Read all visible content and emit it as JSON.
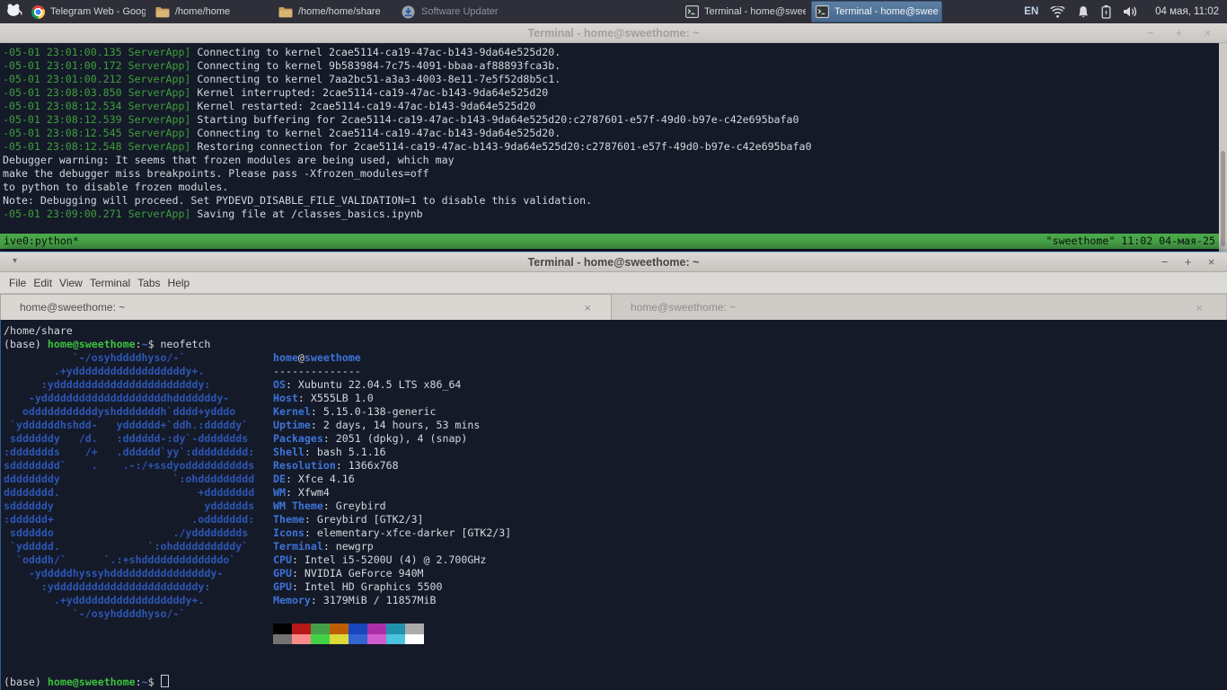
{
  "panel": {
    "taskbar": [
      {
        "icon": "chrome",
        "label": "Telegram Web - Google C...",
        "active": false,
        "dim": false
      },
      {
        "icon": "folder",
        "label": "/home/home",
        "active": false,
        "dim": false
      },
      {
        "icon": "folder",
        "label": "/home/home/share",
        "active": false,
        "dim": false
      },
      {
        "icon": "updater",
        "label": "Software Updater",
        "active": false,
        "dim": true
      },
      {
        "icon": "terminal",
        "label": "Terminal - home@sweeth...",
        "active": false,
        "dim": false
      },
      {
        "icon": "terminal",
        "label": "Terminal - home@sweeth...",
        "active": true,
        "dim": false
      }
    ],
    "tray": {
      "language": "EN",
      "icons": [
        "wifi",
        "bell",
        "battery",
        "volume"
      ],
      "clock": "04 мая, 11:02"
    }
  },
  "background_window": {
    "title": "Terminal - home@sweethome: ~",
    "controls": {
      "minimize": "−",
      "maximize": "+",
      "close": "×"
    },
    "log": [
      {
        "prefix": "-05-01 23:01:00.135 ServerApp]",
        "text": " Connecting to kernel 2cae5114-ca19-47ac-b143-9da64e525d20."
      },
      {
        "prefix": "-05-01 23:01:00.172 ServerApp]",
        "text": " Connecting to kernel 9b583984-7c75-4091-bbaa-af88893fca3b."
      },
      {
        "prefix": "-05-01 23:01:00.212 ServerApp]",
        "text": " Connecting to kernel 7aa2bc51-a3a3-4003-8e11-7e5f52d8b5c1."
      },
      {
        "prefix": "-05-01 23:08:03.850 ServerApp]",
        "text": " Kernel interrupted: 2cae5114-ca19-47ac-b143-9da64e525d20"
      },
      {
        "prefix": "-05-01 23:08:12.534 ServerApp]",
        "text": " Kernel restarted: 2cae5114-ca19-47ac-b143-9da64e525d20"
      },
      {
        "prefix": "-05-01 23:08:12.539 ServerApp]",
        "text": " Starting buffering for 2cae5114-ca19-47ac-b143-9da64e525d20:c2787601-e57f-49d0-b97e-c42e695bafa0"
      },
      {
        "prefix": "-05-01 23:08:12.545 ServerApp]",
        "text": " Connecting to kernel 2cae5114-ca19-47ac-b143-9da64e525d20."
      },
      {
        "prefix": "-05-01 23:08:12.548 ServerApp]",
        "text": " Restoring connection for 2cae5114-ca19-47ac-b143-9da64e525d20:c2787601-e57f-49d0-b97e-c42e695bafa0"
      },
      {
        "prefix": "",
        "text": "Debugger warning: It seems that frozen modules are being used, which may"
      },
      {
        "prefix": "",
        "text": "make the debugger miss breakpoints. Please pass -Xfrozen_modules=off"
      },
      {
        "prefix": "",
        "text": "to python to disable frozen modules."
      },
      {
        "prefix": "",
        "text": "Note: Debugging will proceed. Set PYDEVD_DISABLE_FILE_VALIDATION=1 to disable this validation."
      },
      {
        "prefix": "-05-01 23:09:00.271 ServerApp]",
        "text": " Saving file at /classes_basics.ipynb"
      }
    ],
    "screen_bar": {
      "left": "ive0:python*",
      "right": "\"sweethome\" 11:02 04-мая-25"
    }
  },
  "window": {
    "title": "Terminal - home@sweethome: ~",
    "controls": {
      "minimize": "−",
      "maximize": "+",
      "close": "×"
    },
    "menu": [
      "File",
      "Edit",
      "View",
      "Terminal",
      "Tabs",
      "Help"
    ],
    "tabs": [
      {
        "label": "home@sweethome: ~",
        "active": true,
        "close": "×"
      },
      {
        "label": "home@sweethome: ~",
        "active": false,
        "close": "×"
      }
    ],
    "terminal": {
      "line1": "/home/share",
      "prompt": {
        "env": "(base) ",
        "user": "home@sweethome",
        "colon": ":",
        "path": "~",
        "dollar": "$ ",
        "command": "neofetch"
      },
      "neofetch": {
        "ascii": [
          "           `-/osyhddddhyso/-`",
          "        .+yddddddddddddddddddy+.",
          "      :ydddddddddddddddddddddddy:",
          "    -yddddddddddddddddddddhdddddddy-",
          "   odddddddddddyshdddddddh`dddd+ydddo",
          " `yddddddhshdd-   ydddddd+`ddh.:dddddy`",
          " sddddddy   /d.   :dddddd-:dy`-ddddddds",
          ":ddddddds    /+   .dddddd`yy`:ddddddddd:",
          "sdddddddd`    .    .-:/+ssdyodddddddddds",
          "ddddddddy                  `:ohddddddddd",
          "dddddddd.                      +dddddddd",
          "sddddddy                        ydddddds",
          ":dddddd+                      .oddddddd:",
          " sdddddo                   ./ydddddddds",
          " `yddddd.              `:ohddddddddddy`",
          "  `odddh/`      `.:+shdddddddddddddo`",
          "    -ydddddhyssyhddddddddddddddddy-",
          "      :ydddddddddddddddddddddddy:",
          "        .+yddddddddddddddddddy+.",
          "           `-/osyhddddhyso/-`"
        ],
        "header": {
          "user": "home",
          "at": "@",
          "host": "sweethome"
        },
        "separator": "--------------",
        "info": [
          {
            "label": "OS",
            "value": "Xubuntu 22.04.5 LTS x86_64"
          },
          {
            "label": "Host",
            "value": "X555LB 1.0"
          },
          {
            "label": "Kernel",
            "value": "5.15.0-138-generic"
          },
          {
            "label": "Uptime",
            "value": "2 days, 14 hours, 53 mins"
          },
          {
            "label": "Packages",
            "value": "2051 (dpkg), 4 (snap)"
          },
          {
            "label": "Shell",
            "value": "bash 5.1.16"
          },
          {
            "label": "Resolution",
            "value": "1366x768"
          },
          {
            "label": "DE",
            "value": "Xfce 4.16"
          },
          {
            "label": "WM",
            "value": "Xfwm4"
          },
          {
            "label": "WM Theme",
            "value": "Greybird"
          },
          {
            "label": "Theme",
            "value": "Greybird [GTK2/3]"
          },
          {
            "label": "Icons",
            "value": "elementary-xfce-darker [GTK2/3]"
          },
          {
            "label": "Terminal",
            "value": "newgrp"
          },
          {
            "label": "CPU",
            "value": "Intel i5-5200U (4) @ 2.700GHz"
          },
          {
            "label": "GPU",
            "value": "NVIDIA GeForce 940M"
          },
          {
            "label": "GPU",
            "value": "Intel HD Graphics 5500"
          },
          {
            "label": "Memory",
            "value": "3179MiB / 11857MiB"
          }
        ],
        "palette_row1": [
          "#000000",
          "#b81818",
          "#44a048",
          "#bb5e00",
          "#1a46bd",
          "#aa30aa",
          "#2191ab",
          "#aaaaaa"
        ],
        "palette_row2": [
          "#737373",
          "#fb8a8a",
          "#44d044",
          "#dcd93a",
          "#3264d2",
          "#cf5ccf",
          "#49c3e0",
          "#ffffff"
        ]
      },
      "prompt2": {
        "env": "(base) ",
        "user": "home@sweethome",
        "colon": ":",
        "path": "~",
        "dollar": "$ "
      }
    }
  },
  "colors": {
    "panel_bg": "#2f2f39",
    "screen_bar_green": "#4aa84a",
    "log_timestamp_green": "#3f9f3c",
    "prompt_green": "#3cc13c",
    "path_blue": "#3c6eb4",
    "ascii_art_blue": "#2c55b2",
    "info_label_blue": "#3d74d8",
    "terminal_bg": "#151a29",
    "terminal_fg": "#d4d7dc"
  }
}
